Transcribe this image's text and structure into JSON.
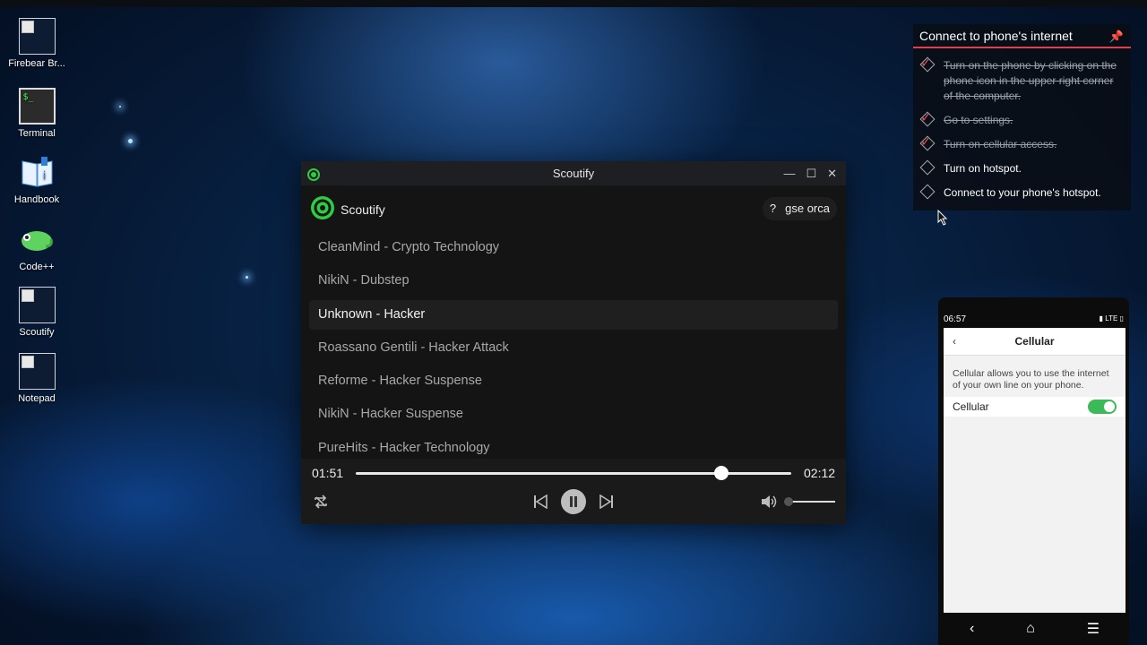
{
  "desktop": {
    "icons": [
      {
        "label": "Firebear Br..."
      },
      {
        "label": "Terminal",
        "glyph": "$_"
      },
      {
        "label": "Handbook"
      },
      {
        "label": "Code++"
      },
      {
        "label": "Scoutify"
      },
      {
        "label": "Notepad"
      }
    ]
  },
  "window": {
    "title": "Scoutify",
    "brand": "Scoutify",
    "user": {
      "help": "?",
      "name": "gse orca"
    },
    "tracks": [
      "CleanMind - Crypto Technology",
      "NikiN - Dubstep",
      "Unknown - Hacker",
      "Roassano Gentili - Hacker Attack",
      "Reforme - Hacker Suspense",
      "NikiN - Hacker Suspense",
      "PureHits - Hacker Technology"
    ],
    "active_track_index": 2,
    "player": {
      "elapsed": "01:51",
      "duration": "02:12",
      "progress_fraction": 0.84,
      "volume_fraction": 0.0
    }
  },
  "task": {
    "title": "Connect to phone's internet",
    "steps": [
      {
        "text": "Turn on the phone by clicking on the phone icon in the upper right corner of the computer.",
        "done": true
      },
      {
        "text": "Go to settings.",
        "done": true
      },
      {
        "text": "Turn on cellular access.",
        "done": true
      },
      {
        "text": "Turn on hotspot.",
        "done": false
      },
      {
        "text": "Connect to your phone's hotspot.",
        "done": false
      }
    ]
  },
  "phone": {
    "time": "06:57",
    "network": "LTE",
    "screen_title": "Cellular",
    "description": "Cellular allows you to use the internet of your own line on your phone.",
    "row_label": "Cellular",
    "toggle_on": true
  },
  "colors": {
    "accent_green": "#3cba5a",
    "scoutify_green": "#2ecc40",
    "task_red": "#e0404a"
  }
}
